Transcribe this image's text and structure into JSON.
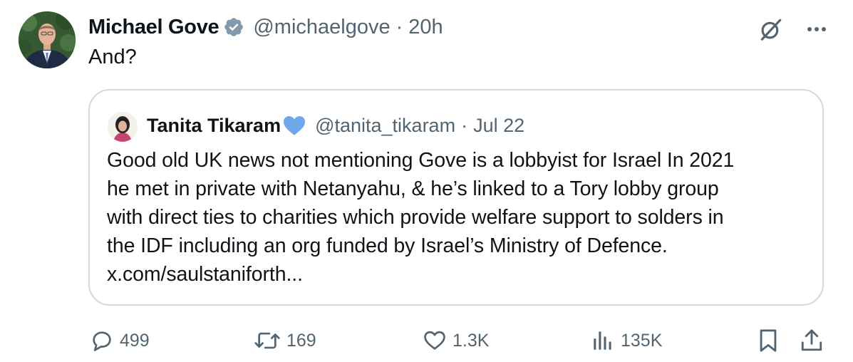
{
  "tweet": {
    "author": {
      "display_name": "Michael Gove",
      "handle": "@michaelgove",
      "separator": "·",
      "time": "20h"
    },
    "text": "And?",
    "quoted": {
      "author": {
        "display_name": "Tanita Tikaram",
        "handle": "@tanita_tikaram",
        "separator": "·",
        "date": "Jul 22"
      },
      "lines": [
        "Good old UK news not mentioning Gove is a lobbyist for Israel In 2021",
        "he met in private with Netanyahu, & he’s linked to a Tory lobby group",
        "with direct ties to charities which provide welfare support to solders in",
        "the IDF including an org funded by Israel’s Ministry of Defence.",
        "x.com/saulstaniforth..."
      ]
    },
    "actions": {
      "replies": "499",
      "reposts": "169",
      "likes": "1.3K",
      "views": "135K"
    },
    "icons": {
      "verified": "verified-badge-icon",
      "grok": "grok-icon",
      "more": "more-icon",
      "heart_badge": "blue-heart-icon",
      "reply": "reply-icon",
      "repost": "repost-icon",
      "like": "like-icon",
      "views": "views-icon",
      "bookmark": "bookmark-icon",
      "share": "share-icon"
    },
    "colors": {
      "text_primary": "#0f1419",
      "text_secondary": "#536471",
      "border": "#cfd9de",
      "heart_blue": "#6fa8e8"
    }
  }
}
